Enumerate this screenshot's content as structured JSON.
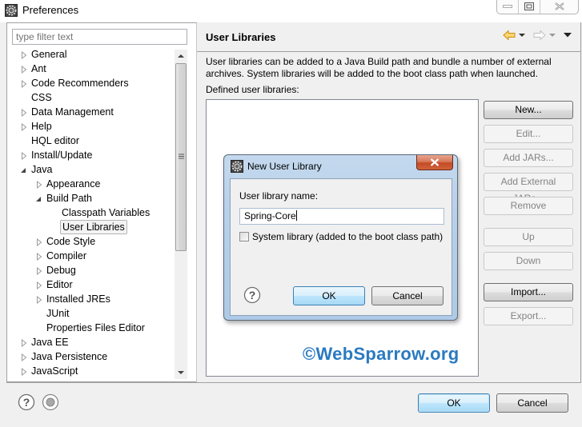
{
  "window": {
    "title": "Preferences",
    "icon": "gear-icon",
    "controls": [
      "minimize",
      "maximize",
      "close"
    ]
  },
  "left_pane": {
    "filter_placeholder": "type filter text",
    "tree": [
      {
        "label": "General",
        "level": 0,
        "state": "collapsed"
      },
      {
        "label": "Ant",
        "level": 0,
        "state": "collapsed"
      },
      {
        "label": "Code Recommenders",
        "level": 0,
        "state": "collapsed"
      },
      {
        "label": "CSS",
        "level": 0,
        "state": "leaf"
      },
      {
        "label": "Data Management",
        "level": 0,
        "state": "collapsed"
      },
      {
        "label": "Help",
        "level": 0,
        "state": "collapsed"
      },
      {
        "label": "HQL editor",
        "level": 0,
        "state": "leaf"
      },
      {
        "label": "Install/Update",
        "level": 0,
        "state": "collapsed"
      },
      {
        "label": "Java",
        "level": 0,
        "state": "expanded"
      },
      {
        "label": "Appearance",
        "level": 1,
        "state": "collapsed"
      },
      {
        "label": "Build Path",
        "level": 1,
        "state": "expanded"
      },
      {
        "label": "Classpath Variables",
        "level": 2,
        "state": "leaf"
      },
      {
        "label": "User Libraries",
        "level": 2,
        "state": "leaf",
        "selected": true
      },
      {
        "label": "Code Style",
        "level": 1,
        "state": "collapsed"
      },
      {
        "label": "Compiler",
        "level": 1,
        "state": "collapsed"
      },
      {
        "label": "Debug",
        "level": 1,
        "state": "collapsed"
      },
      {
        "label": "Editor",
        "level": 1,
        "state": "collapsed"
      },
      {
        "label": "Installed JREs",
        "level": 1,
        "state": "collapsed"
      },
      {
        "label": "JUnit",
        "level": 1,
        "state": "leaf"
      },
      {
        "label": "Properties Files Editor",
        "level": 1,
        "state": "leaf"
      },
      {
        "label": "Java EE",
        "level": 0,
        "state": "collapsed"
      },
      {
        "label": "Java Persistence",
        "level": 0,
        "state": "collapsed"
      },
      {
        "label": "JavaScript",
        "level": 0,
        "state": "collapsed"
      }
    ]
  },
  "page": {
    "title": "User Libraries",
    "description": "User libraries can be added to a Java Build path and bundle a number of external archives. System libraries will be added to the boot class path when launched.",
    "defined_label": "Defined user libraries:",
    "buttons": [
      {
        "label": "New...",
        "enabled": true
      },
      {
        "label": "Edit...",
        "enabled": false
      },
      {
        "label": "Add JARs...",
        "enabled": false
      },
      {
        "label": "Add External JARs...",
        "enabled": false
      },
      {
        "label": "Remove",
        "enabled": false
      },
      {
        "label": "Up",
        "enabled": false
      },
      {
        "label": "Down",
        "enabled": false
      },
      {
        "label": "Import...",
        "enabled": true
      },
      {
        "label": "Export...",
        "enabled": false
      }
    ],
    "watermark": "©WebSparrow.org"
  },
  "dialog": {
    "title": "New User Library",
    "name_label": "User library name:",
    "name_value": "Spring-Core",
    "system_checkbox_label": "System library (added to the boot class path)",
    "system_checked": false,
    "ok_label": "OK",
    "cancel_label": "Cancel"
  },
  "footer": {
    "ok_label": "OK",
    "cancel_label": "Cancel"
  },
  "colors": {
    "watermark": "#2a7ac0",
    "default_button_border": "#3c7fb1",
    "back_arrow": "#f0a020"
  }
}
